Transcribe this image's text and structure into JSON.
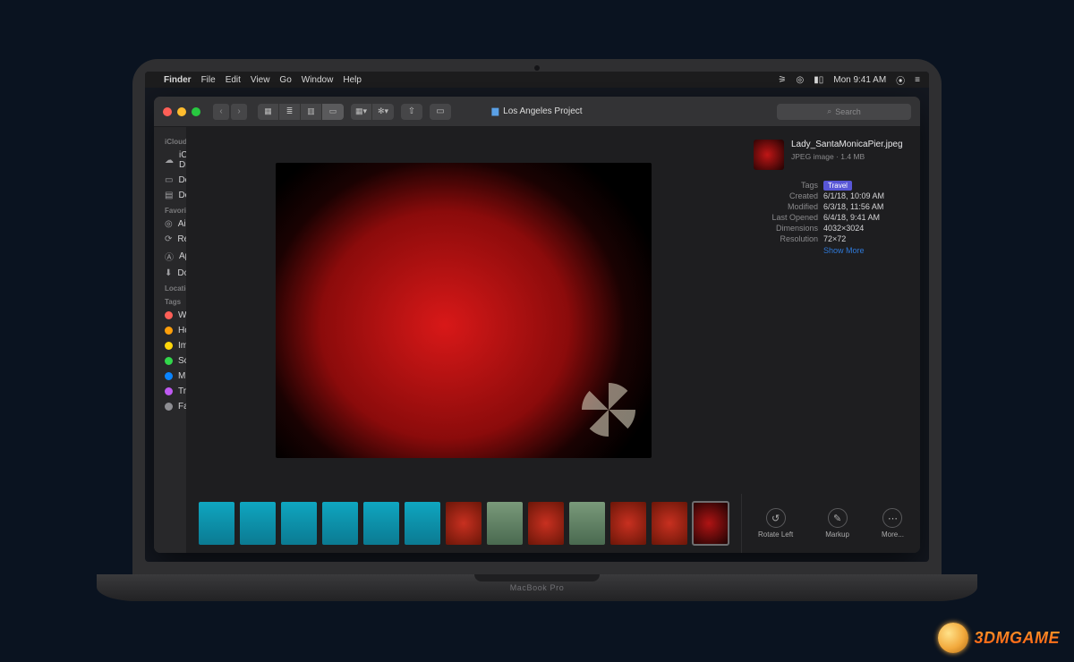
{
  "laptop_brand": "MacBook Pro",
  "menubar": {
    "app": "Finder",
    "items": [
      "File",
      "Edit",
      "View",
      "Go",
      "Window",
      "Help"
    ],
    "clock": "Mon 9:41 AM"
  },
  "window": {
    "title": "Los Angeles Project",
    "search_placeholder": "Search"
  },
  "sidebar": {
    "sections": [
      {
        "header": "iCloud",
        "items": [
          {
            "icon": "cloud",
            "label": "iCloud Drive"
          },
          {
            "icon": "desktop",
            "label": "Desktop"
          },
          {
            "icon": "doc",
            "label": "Documents"
          }
        ]
      },
      {
        "header": "Favorites",
        "items": [
          {
            "icon": "airdrop",
            "label": "AirDrop"
          },
          {
            "icon": "clock",
            "label": "Recents"
          },
          {
            "icon": "app",
            "label": "Applications"
          },
          {
            "icon": "download",
            "label": "Downloads"
          }
        ]
      },
      {
        "header": "Locations",
        "items": []
      },
      {
        "header": "Tags",
        "items": [
          {
            "color": "#ff5f57",
            "label": "Work"
          },
          {
            "color": "#ff9f0a",
            "label": "Home"
          },
          {
            "color": "#ffd60a",
            "label": "Important"
          },
          {
            "color": "#32d74b",
            "label": "School"
          },
          {
            "color": "#0a84ff",
            "label": "Music"
          },
          {
            "color": "#bf5af2",
            "label": "Travel"
          },
          {
            "color": "#8e8e93",
            "label": "Family"
          }
        ]
      }
    ]
  },
  "info": {
    "filename": "Lady_SantaMonicaPier.jpeg",
    "subtitle": "JPEG image · 1.4 MB",
    "rows": [
      {
        "label": "Tags",
        "value": "Travel",
        "tag": true
      },
      {
        "label": "Created",
        "value": "6/1/18, 10:09 AM"
      },
      {
        "label": "Modified",
        "value": "6/3/18, 11:56 AM"
      },
      {
        "label": "Last Opened",
        "value": "6/4/18, 9:41 AM"
      },
      {
        "label": "Dimensions",
        "value": "4032×3024"
      },
      {
        "label": "Resolution",
        "value": "72×72"
      }
    ],
    "show_more": "Show More"
  },
  "thumbnails": [
    {
      "class": "t-pool"
    },
    {
      "class": "t-pool"
    },
    {
      "class": "t-pool"
    },
    {
      "class": "t-pool"
    },
    {
      "class": "t-pool"
    },
    {
      "class": "t-pool"
    },
    {
      "class": "t-red"
    },
    {
      "class": "t-grp"
    },
    {
      "class": "t-red"
    },
    {
      "class": "t-grp"
    },
    {
      "class": "t-red"
    },
    {
      "class": "t-red"
    },
    {
      "class": "t-dark",
      "selected": true
    }
  ],
  "actions": [
    {
      "icon": "↺",
      "label": "Rotate Left"
    },
    {
      "icon": "✎",
      "label": "Markup"
    },
    {
      "icon": "⋯",
      "label": "More..."
    }
  ],
  "watermark": "3DMGAME"
}
